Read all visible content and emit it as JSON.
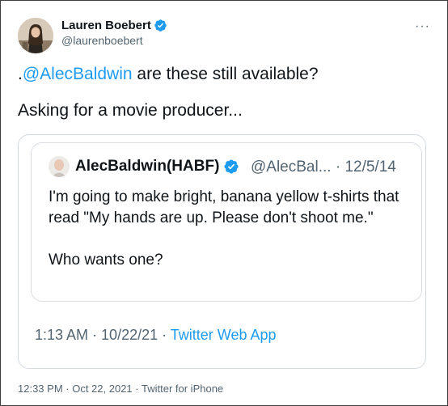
{
  "author": {
    "name": "Lauren Boebert",
    "handle": "@laurenboebert"
  },
  "menu_glyph": "···",
  "tweet": {
    "mention_prefix": ".",
    "mention": "@AlecBaldwin",
    "line1_rest": " are these still available?",
    "line2": "Asking for a movie producer..."
  },
  "quoted_tweet": {
    "name": "AlecBaldwin(HABF)",
    "handle": "@AlecBal...",
    "separator": " · ",
    "date": "12/5/14",
    "paragraph1": "I'm going to make bright, banana yellow t-shirts that read \"My hands are up. Please don't shoot me.\"",
    "paragraph2": "Who wants one?"
  },
  "card_meta": {
    "time": "1:13 AM",
    "date": "10/22/21",
    "separator": " · ",
    "app": "Twitter Web App"
  },
  "footer_meta": {
    "time": "12:33 PM",
    "date": "Oct 22, 2021",
    "separator": " · ",
    "app": "Twitter for iPhone"
  },
  "colors": {
    "link": "#1d9bf0",
    "secondary_text": "#536471",
    "primary_text": "#0f1419",
    "verified_badge": "#1d9bf0"
  },
  "icons": {
    "author_verified": "verified-badge-icon",
    "quoted_verified": "verified-badge-icon",
    "more": "more-options-icon"
  }
}
